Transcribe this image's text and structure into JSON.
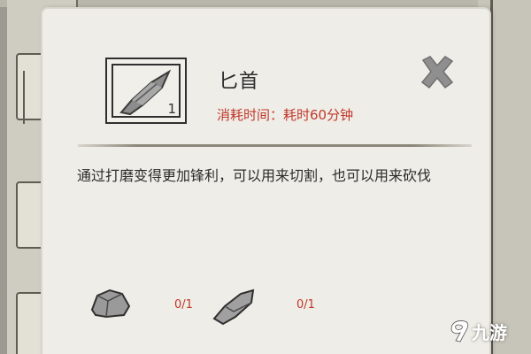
{
  "item": {
    "name": "匕首",
    "count": "1",
    "icon": "dagger-icon",
    "cost_text": "消耗时间：耗时60分钟",
    "description": "通过打磨变得更加锋利，可以用来切割，也可以用来砍伐"
  },
  "close": {
    "icon": "close-icon"
  },
  "materials": [
    {
      "icon": "rock-icon",
      "count": "0/1"
    },
    {
      "icon": "flint-shard-icon",
      "count": "0/1"
    }
  ],
  "watermark": {
    "icon": "9you-logo-icon",
    "text": "九游"
  },
  "colors": {
    "dialog_bg": "#efede7",
    "accent_red": "#c0392b",
    "text_dark": "#2b2b2b",
    "close_grey": "#8a8a8a"
  }
}
